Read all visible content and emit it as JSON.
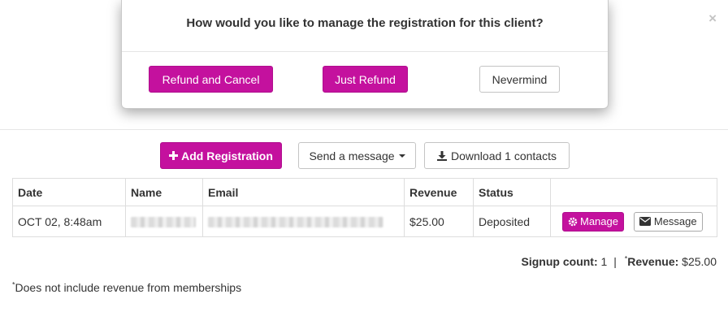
{
  "modal": {
    "question": "How would you like to manage the registration for this client?",
    "refund_cancel_label": "Refund and Cancel",
    "just_refund_label": "Just Refund",
    "nevermind_label": "Nevermind"
  },
  "close_glyph": "×",
  "toolbar": {
    "add_registration_label": "Add Registration",
    "send_message_label": "Send a message",
    "download_label": "Download 1 contacts"
  },
  "table": {
    "headers": [
      "Date",
      "Name",
      "Email",
      "Revenue",
      "Status",
      ""
    ],
    "rows": [
      {
        "date": "OCT 02, 8:48am",
        "revenue": "$25.00",
        "status": "Deposited",
        "manage_label": "Manage",
        "message_label": "Message"
      }
    ]
  },
  "summary": {
    "signup_label": "Signup count:",
    "signup_value": "1",
    "separator": "|",
    "revenue_asterisk": "*",
    "revenue_label": "Revenue:",
    "revenue_value": "$25.00"
  },
  "footnote": {
    "asterisk": "*",
    "text": "Does not include revenue from memberships"
  },
  "colors": {
    "accent": "#c4119e",
    "success": "#1a8a1a"
  },
  "icons": {
    "add": "plus-icon",
    "download": "download-icon",
    "manage": "gear-icon",
    "message": "envelope-icon",
    "dropdown": "caret-down-icon"
  }
}
